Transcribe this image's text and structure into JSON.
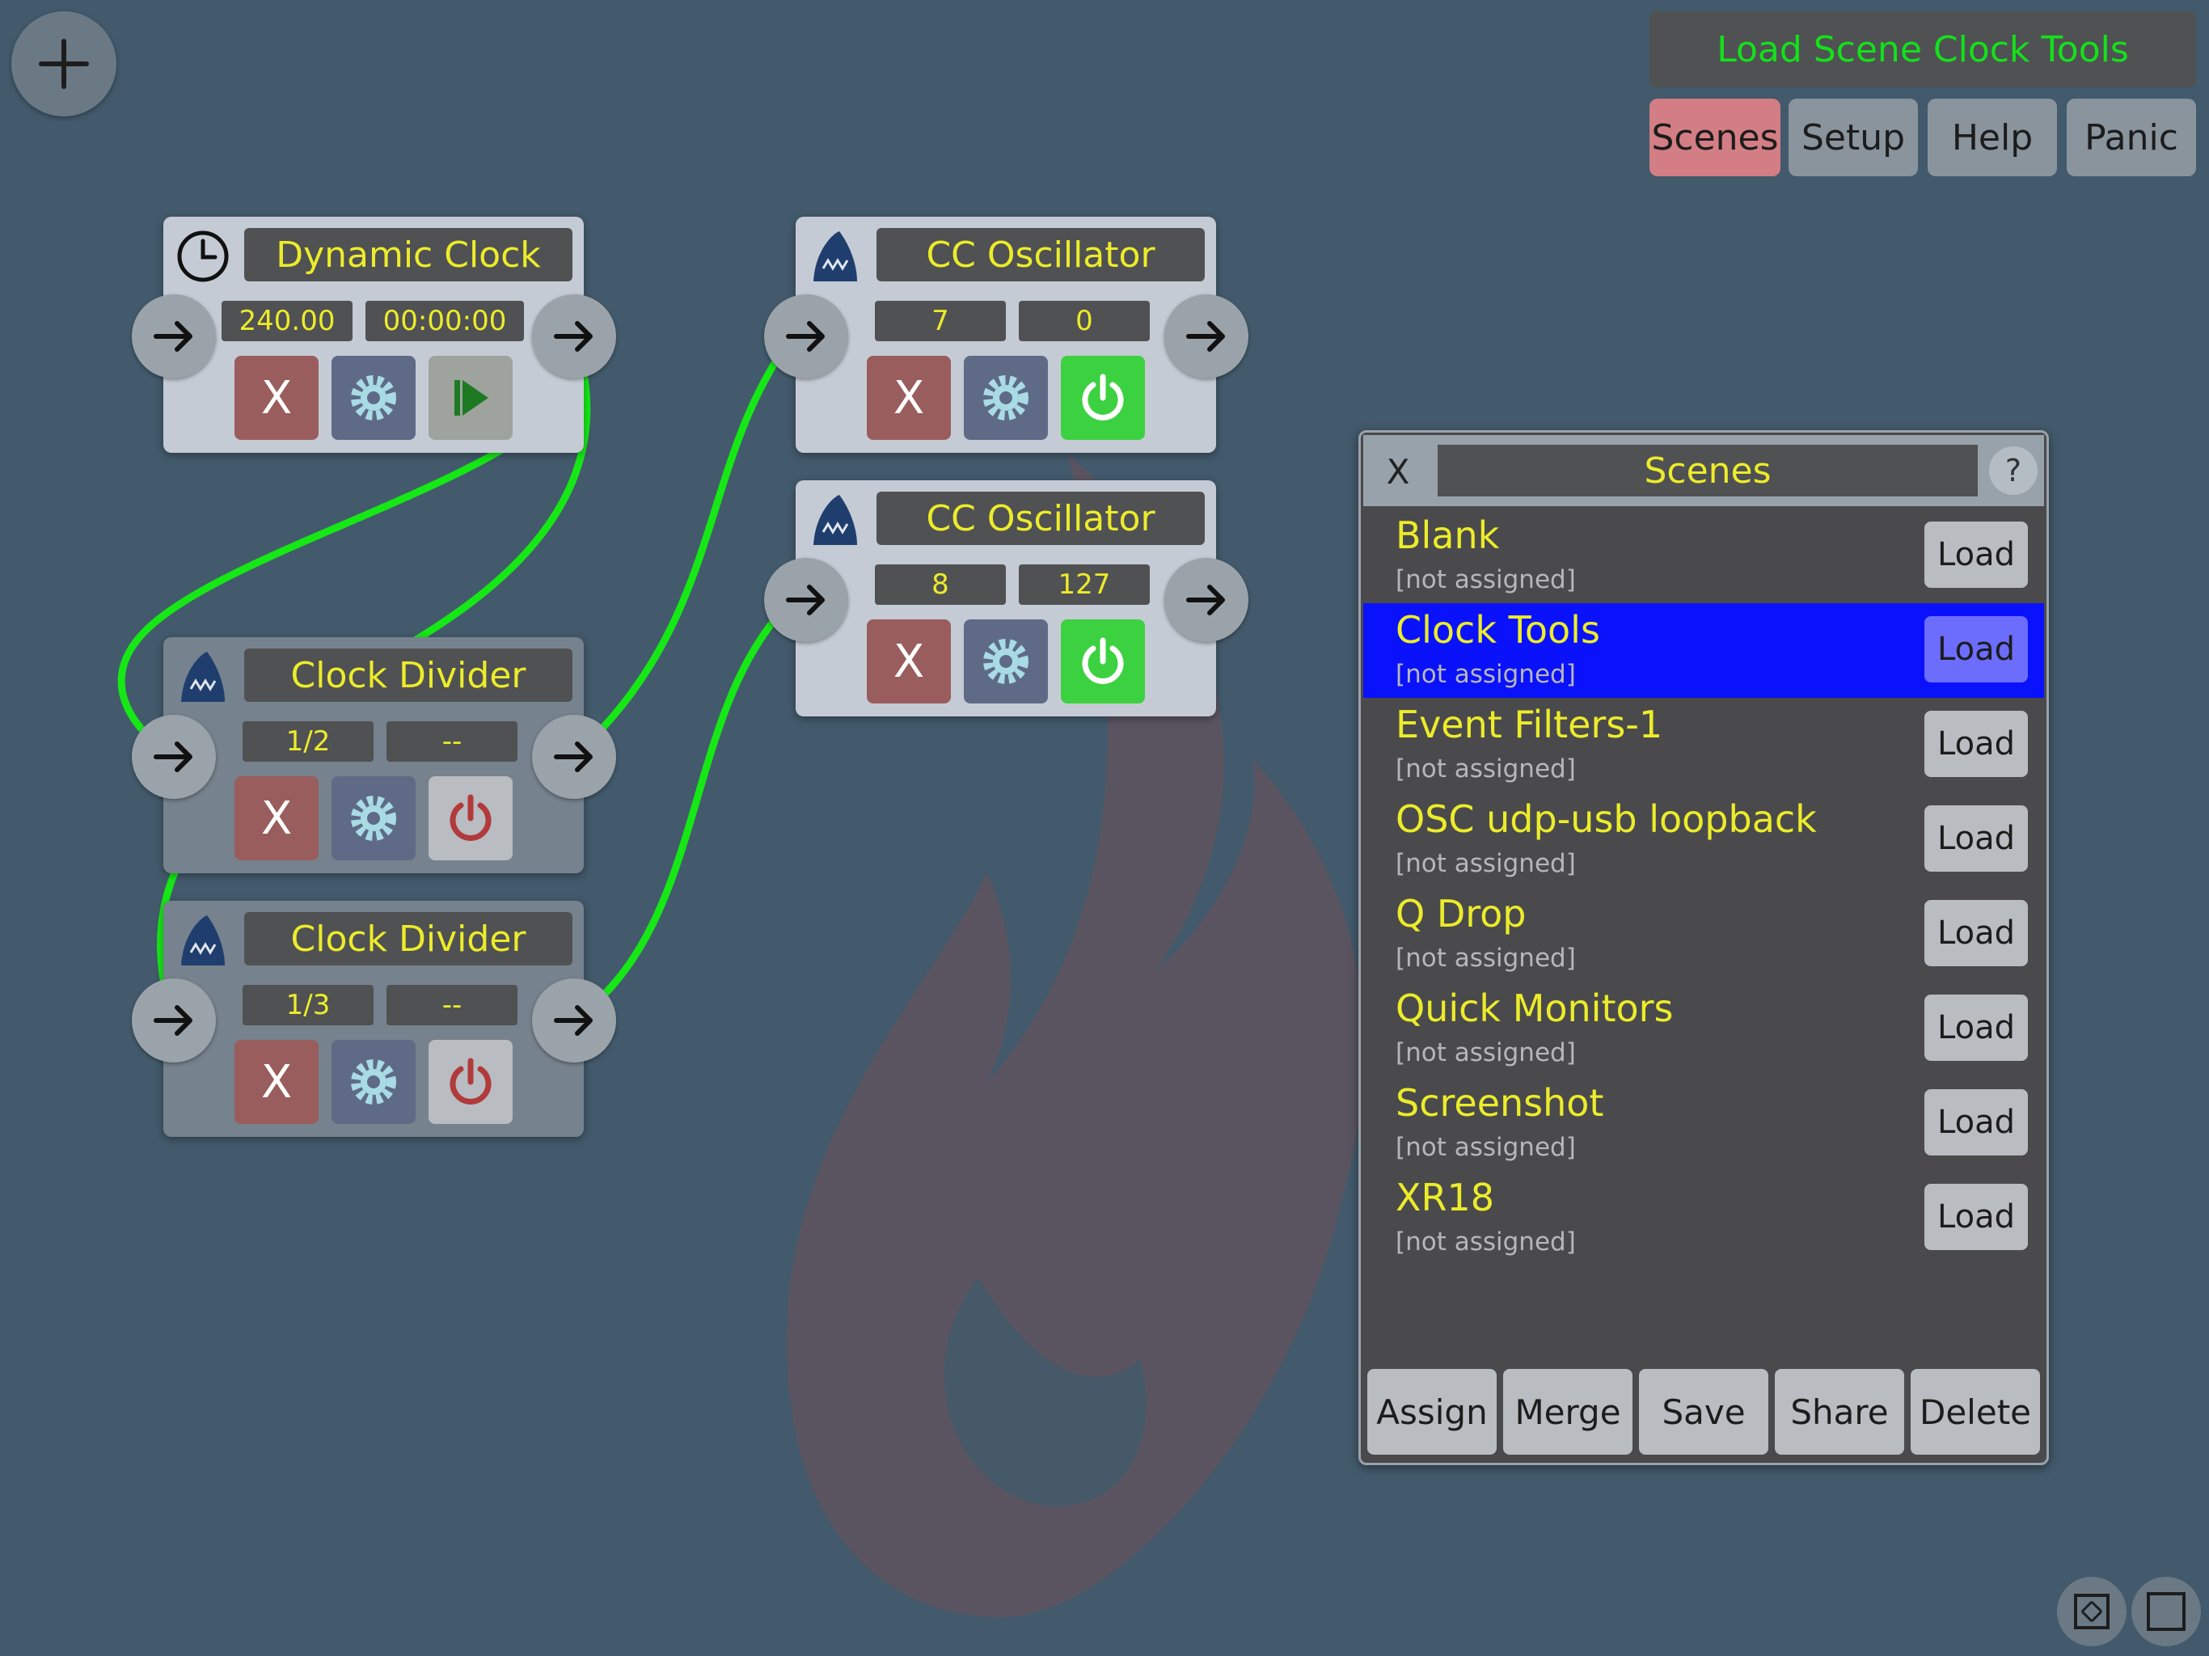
{
  "toolbar": {
    "add_icon": "plus-icon",
    "scene_label": "Load Scene Clock Tools",
    "tabs": [
      {
        "label": "Scenes",
        "active": true
      },
      {
        "label": "Setup",
        "active": false
      },
      {
        "label": "Help",
        "active": false
      },
      {
        "label": "Panic",
        "active": false
      }
    ]
  },
  "modules": [
    {
      "title": "Dynamic Clock",
      "icon": "clock-icon",
      "fields": [
        "240.00",
        "00:00:00"
      ],
      "action": "play"
    },
    {
      "title": "Clock Divider",
      "icon": "shark-icon",
      "fields": [
        "1/2",
        "--"
      ],
      "action": "power-off"
    },
    {
      "title": "Clock Divider",
      "icon": "shark-icon",
      "fields": [
        "1/3",
        "--"
      ],
      "action": "power-off"
    },
    {
      "title": "CC Oscillator",
      "icon": "shark-icon",
      "fields": [
        "7",
        "0"
      ],
      "action": "power-on"
    },
    {
      "title": "CC Oscillator",
      "icon": "shark-icon",
      "fields": [
        "8",
        "127"
      ],
      "action": "power-on"
    }
  ],
  "module_buttons": {
    "remove": "X"
  },
  "scenes_panel": {
    "close": "X",
    "title": "Scenes",
    "help": "?",
    "load_label": "Load",
    "items": [
      {
        "name": "Blank",
        "sub": "[not assigned]",
        "selected": false
      },
      {
        "name": "Clock Tools",
        "sub": "[not assigned]",
        "selected": true
      },
      {
        "name": "Event Filters-1",
        "sub": "[not assigned]",
        "selected": false
      },
      {
        "name": "OSC udp-usb loopback",
        "sub": "[not assigned]",
        "selected": false
      },
      {
        "name": "Q Drop",
        "sub": "[not assigned]",
        "selected": false
      },
      {
        "name": "Quick Monitors",
        "sub": "[not assigned]",
        "selected": false
      },
      {
        "name": "Screenshot",
        "sub": "[not assigned]",
        "selected": false
      },
      {
        "name": "XR18",
        "sub": "[not assigned]",
        "selected": false
      }
    ],
    "footer": [
      "Assign",
      "Merge",
      "Save",
      "Share",
      "Delete"
    ]
  },
  "colors": {
    "background": "#425a6b",
    "wire": "#16e816",
    "label_yellow": "#ecec2a",
    "scene_label_green": "#13e11b",
    "selected_row": "#0a12fb",
    "scenes_tab": "#d37e84"
  }
}
